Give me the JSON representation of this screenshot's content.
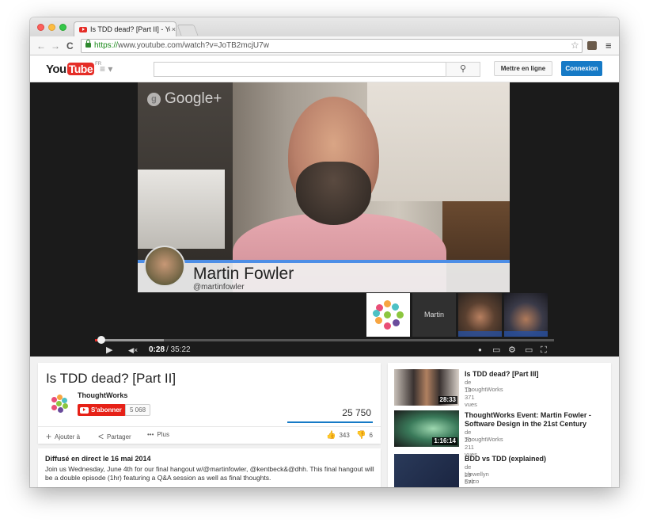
{
  "browser": {
    "tab_title": "Is TDD dead? [Part II] - You",
    "tab_close": "×",
    "url_scheme": "https://",
    "url_rest": "www.youtube.com/watch?v=JoTB2mcjU7w",
    "back": "←",
    "forward": "→",
    "reload": "C",
    "star": "☆",
    "menu": "≡"
  },
  "header": {
    "logo_you": "You",
    "logo_tube": "Tube",
    "logo_region": "FR",
    "guide": "≡ ▾",
    "search_placeholder": "",
    "search_icon": "⚲",
    "upload_label": "Mettre en ligne",
    "signin_label": "Connexion",
    "signin_color": "#167ac6"
  },
  "player": {
    "brand_glyph": "g",
    "brand_text": "Google+",
    "lower_third_name": "Martin Fowler",
    "lower_third_handle": "@martinfowler",
    "participant_label": "Martin",
    "time_current": "0:28",
    "time_total": "/ 35:22",
    "progress_played": 0.013,
    "progress_buffered": 0.15,
    "play_icon": "▶",
    "volume_icon": "◀×",
    "fullscreen_icon": "⛶",
    "settings_icon": "⚙",
    "annotations_icon": "●",
    "captions_icon": "▭",
    "theater_icon": "▭"
  },
  "video": {
    "title": "Is TDD dead? [Part II]",
    "channel": "ThoughtWorks",
    "subscribe_label": "S'abonner",
    "subscriber_count": "5 068",
    "view_count": "25 750",
    "add_label": "Ajouter à",
    "share_label": "Partager",
    "more_label": "Plus",
    "likes": "343",
    "dislikes": "6",
    "add_icon": "+",
    "share_icon": "<",
    "more_icon": "•••",
    "like_icon": "👍",
    "dislike_icon": "👎"
  },
  "description": {
    "title": "Diffusé en direct le 16 mai 2014",
    "text": "Join us Wednesday, June 4th for our final hangout  w/@martinfowler, @kentbeck&@dhh. This final hangout will be a double episode (1hr) featuring a Q&A session as well as final thoughts."
  },
  "related": [
    {
      "title": "Is TDD dead? [Part III]",
      "by": "de ThoughtWorks",
      "views": "13 371 vues",
      "duration": "28:33"
    },
    {
      "title": "ThoughtWorks Event: Martin Fowler - Software Design in the 21st Century",
      "by": "de ThoughtWorks",
      "views": "20 211 vues",
      "duration": "1:16:14"
    },
    {
      "title": "BDD vs TDD (explained)",
      "by": "de Llewellyn Falco",
      "views": "29 577 vues",
      "duration": ""
    }
  ]
}
